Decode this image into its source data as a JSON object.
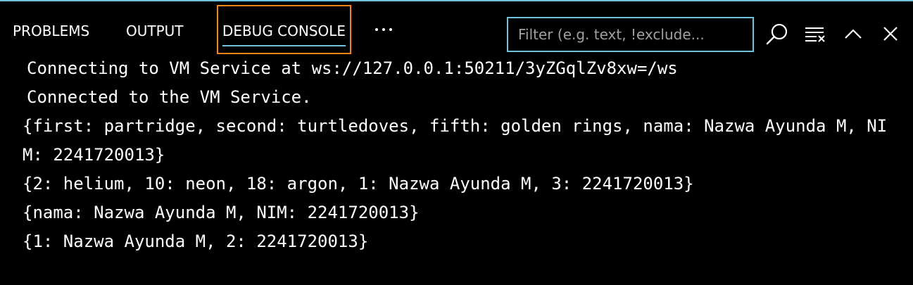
{
  "panel": {
    "tabs": [
      {
        "label": "PROBLEMS"
      },
      {
        "label": "OUTPUT"
      },
      {
        "label": "DEBUG CONSOLE"
      }
    ],
    "more_label": "⋯",
    "filter": {
      "placeholder": "Filter (e.g. text, !exclude..."
    },
    "icons": [
      "search-icon",
      "clear-console-icon",
      "chevron-up-icon",
      "close-icon"
    ]
  },
  "console": {
    "lines": [
      "Connecting to VM Service at ws://127.0.0.1:50211/3yZGqlZv8xw=/ws",
      "Connected to the VM Service.",
      "{first: partridge, second: turtledoves, fifth: golden rings, nama: Nazwa Ayunda M, NIM: 2241720013}",
      "{2: helium, 10: neon, 18: argon, 1: Nazwa Ayunda M, 3: 2241720013}",
      "{nama: Nazwa Ayunda M, NIM: 2241720013}",
      "{1: Nazwa Ayunda M, 2: 2241720013}"
    ]
  },
  "colors": {
    "background": "#000000",
    "accent": "#6fc3df",
    "focus_border": "#f38518",
    "text": "#ffffff"
  }
}
